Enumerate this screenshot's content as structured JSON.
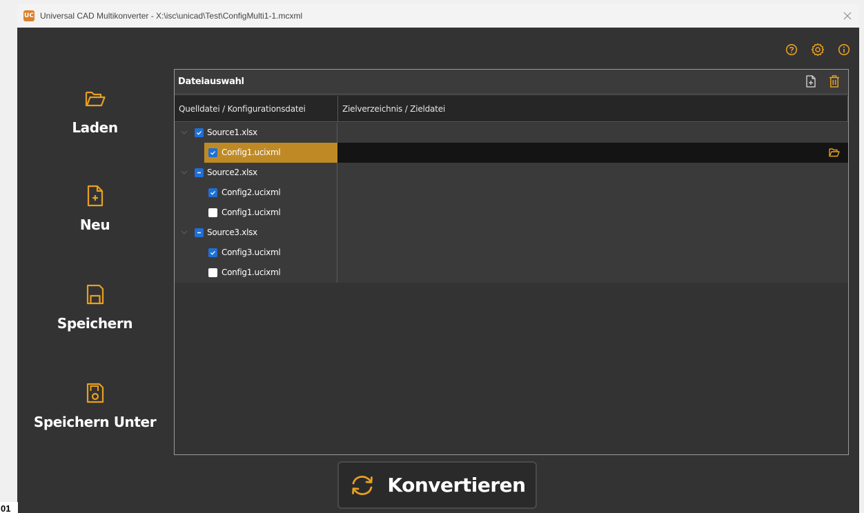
{
  "app": {
    "logo_text": "UC",
    "title": "Universal CAD Multikonverter - X:\\isc\\unicad\\Test\\ConfigMulti1-1.mcxml"
  },
  "top_icons": [
    "help-icon",
    "settings-icon",
    "info-icon"
  ],
  "sidebar": {
    "items": [
      {
        "label": "Laden",
        "icon": "folder-open-icon"
      },
      {
        "label": "Neu",
        "icon": "new-file-icon"
      },
      {
        "label": "Speichern",
        "icon": "save-icon"
      },
      {
        "label": "Speichern Unter",
        "icon": "save-as-icon"
      }
    ]
  },
  "panel": {
    "title": "Dateiauswahl",
    "header_icons": [
      "add-file-icon",
      "trash-icon"
    ],
    "columns": [
      "Quelldatei / Konfigurationsdatei",
      "Zielverzeichnis / Zieldatei"
    ],
    "rows": [
      {
        "label": "Source1.xlsx",
        "level": 0,
        "state": "checked",
        "selected": false
      },
      {
        "label": "Config1.ucixml",
        "level": 1,
        "state": "checked",
        "selected": true,
        "target_icon": "folder-icon"
      },
      {
        "label": "Source2.xlsx",
        "level": 0,
        "state": "partial",
        "selected": false
      },
      {
        "label": "Config2.ucixml",
        "level": 1,
        "state": "checked",
        "selected": false
      },
      {
        "label": "Config1.ucixml",
        "level": 1,
        "state": "unchecked",
        "selected": false
      },
      {
        "label": "Source3.xlsx",
        "level": 0,
        "state": "partial",
        "selected": false
      },
      {
        "label": "Config3.ucixml",
        "level": 1,
        "state": "checked",
        "selected": false
      },
      {
        "label": "Config1.ucixml",
        "level": 1,
        "state": "unchecked",
        "selected": false
      }
    ]
  },
  "convert": {
    "label": "Konvertieren",
    "icon": "refresh-icon"
  },
  "corner_tag": "01",
  "colors": {
    "accent": "#e8a020",
    "background": "#333333",
    "selected_row": "#bf8a25",
    "checkbox": "#1f6fd6"
  }
}
